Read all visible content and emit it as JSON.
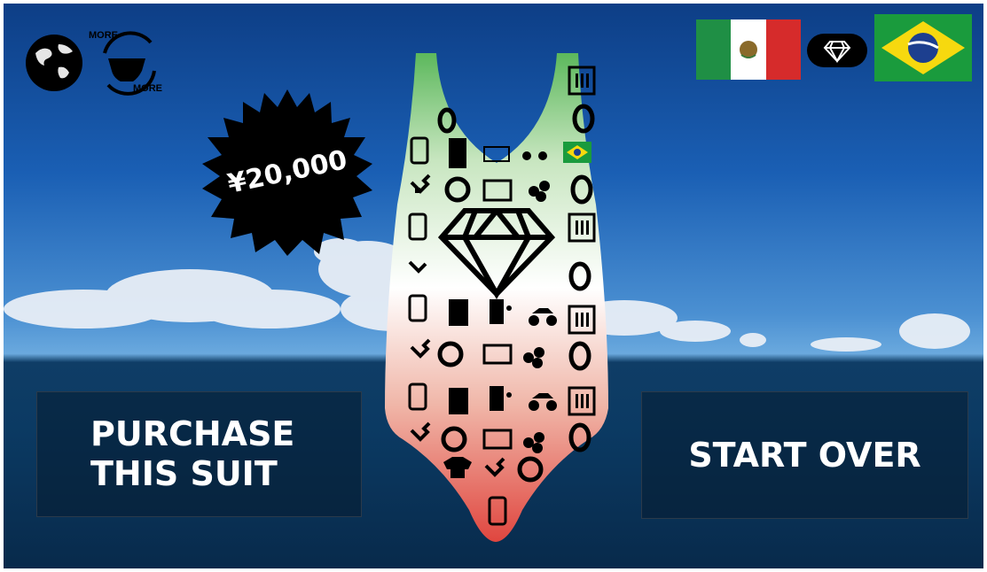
{
  "price": {
    "label": "¥20,000"
  },
  "actions": {
    "purchase_label": "PURCHASE THIS SUIT",
    "start_over_label": "START OVER"
  },
  "corner": {
    "world_icon": "globe-icon",
    "swap_icon": "more-swimsuit-cycle-icon",
    "swap_top_text": "MORE",
    "swap_bottom_text": "MORE"
  },
  "selection": {
    "left_flag": "mexico-flag-icon",
    "middle_icon": "diamond-icon",
    "right_flag": "brazil-flag-icon"
  },
  "colors": {
    "sky_top": "#0d3e86",
    "sea": "#0b3a63",
    "suit_top": "#5cb85c",
    "suit_mid": "#ffffff",
    "suit_bottom": "#e0463f",
    "mx_green": "#1f8f45",
    "mx_red": "#d62b2b",
    "br_green": "#1a9b3d",
    "br_yellow": "#f6d90f",
    "br_blue": "#1d3f8f"
  }
}
